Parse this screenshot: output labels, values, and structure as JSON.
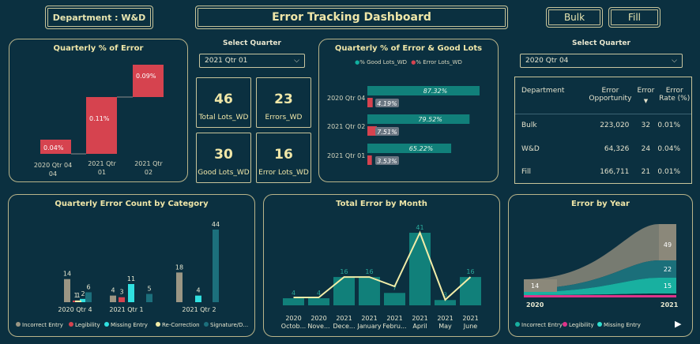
{
  "header": {
    "department_label": "Department : W&D",
    "dashboard_title": "Error Tracking Dashboard",
    "bulk_button": "Bulk",
    "fill_button": "Fill"
  },
  "select_quarter_1": {
    "label": "Select Quarter",
    "value": "2021 Qtr 01"
  },
  "select_quarter_2": {
    "label": "Select Quarter",
    "value": "2020 Qtr 04"
  },
  "kpis": [
    {
      "value": "46",
      "label": "Total Lots_WD"
    },
    {
      "value": "23",
      "label": "Errors_WD"
    },
    {
      "value": "30",
      "label": "Good Lots_WD"
    },
    {
      "value": "16",
      "label": "Error Lots_WD"
    }
  ],
  "dept_table": {
    "headers": [
      "Department",
      "Error Opportunity",
      "Error",
      "Error Rate (%)"
    ],
    "rows": [
      [
        "Bulk",
        "223,020",
        "32",
        "0.01%"
      ],
      [
        "W&D",
        "64,326",
        "24",
        "0.04%"
      ],
      [
        "Fill",
        "166,711",
        "21",
        "0.01%"
      ]
    ]
  },
  "colors": {
    "bg": "#0b3040",
    "teal": "#11807a",
    "red": "#d6434f",
    "gray": "#9b9684",
    "cyan": "#30e0e0",
    "yellow": "#f2eda8",
    "dark_teal": "#1c6f7c",
    "pink": "#e0338a"
  },
  "chart_data": [
    {
      "type": "bar",
      "title": "Quarterly % of Error",
      "categories": [
        "2020 Qtr 04",
        "2021 Qtr 01",
        "2021 Qtr 02"
      ],
      "values": [
        0.04,
        0.11,
        0.09
      ],
      "data_labels": [
        "0.04%",
        "0.11%",
        "0.09%"
      ]
    },
    {
      "type": "bar",
      "title": "Quarterly % of Error & Good Lots",
      "categories": [
        "2020 Qtr 04",
        "2021 Qtr 02",
        "2021 Qtr 01"
      ],
      "series": [
        {
          "name": "% Good Lots_WD",
          "values": [
            87.32,
            79.52,
            65.22
          ],
          "labels": [
            "87.32%",
            "79.52%",
            "65.22%"
          ]
        },
        {
          "name": "% Error Lots_WD",
          "values": [
            4.19,
            7.51,
            3.53
          ],
          "labels": [
            "4.19%",
            "7.51%",
            "3.53%"
          ]
        }
      ]
    },
    {
      "type": "bar",
      "title": "Quarterly Error Count by Category",
      "categories": [
        "2020 Qtr 4",
        "2021 Qtr 1",
        "2021 Qtr 2"
      ],
      "series": [
        {
          "name": "Incorrect Entry",
          "values": [
            14,
            4,
            18
          ]
        },
        {
          "name": "Legibility",
          "values": [
            1,
            3,
            null
          ]
        },
        {
          "name": "Missing Entry",
          "values": [
            2,
            11,
            4
          ]
        },
        {
          "name": "Re-Correction",
          "values": [
            1,
            null,
            null
          ]
        },
        {
          "name": "Signature/D...",
          "values": [
            6,
            5,
            44
          ]
        }
      ]
    },
    {
      "type": "bar",
      "title": "Total Error by Month",
      "categories": [
        "2020 Octob...",
        "2020 Nove...",
        "2021 Dece...",
        "2021 January",
        "2021 Febru...",
        "2021 April",
        "2021 May",
        "2021 June"
      ],
      "values": [
        4,
        4,
        16,
        16,
        7,
        41,
        3,
        16
      ]
    },
    {
      "type": "area",
      "title": "Error by Year",
      "x": [
        "2020",
        "2021"
      ],
      "series": [
        {
          "name": "Incorrect Entry",
          "values": [
            14,
            49
          ]
        },
        {
          "name": "Legibility",
          "values": [
            null,
            22
          ]
        },
        {
          "name": "Missing Entry",
          "values": [
            null,
            15
          ]
        }
      ]
    }
  ]
}
